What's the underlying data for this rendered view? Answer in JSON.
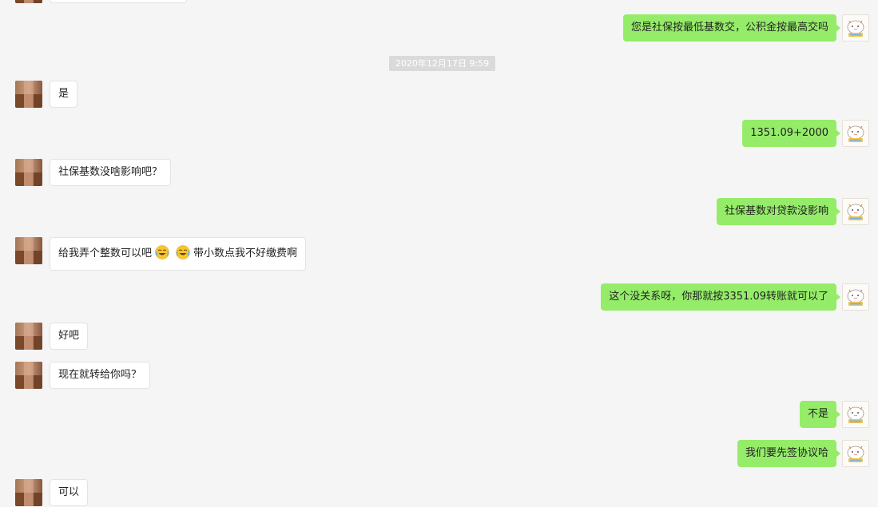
{
  "timestamp": "2020年12月17日 9:59",
  "messages": {
    "m1": {
      "text": "您是社保按最低基数交，公积金按最高交吗",
      "direction": "outgoing"
    },
    "m2": {
      "text": "是",
      "direction": "incoming"
    },
    "m3": {
      "text": "1351.09+2000",
      "direction": "outgoing"
    },
    "m4": {
      "text": "社保基数没啥影响吧？",
      "direction": "incoming"
    },
    "m5": {
      "text": "社保基数对贷款没影响",
      "direction": "outgoing"
    },
    "m6": {
      "text_part1": "给我弄个整数可以吧",
      "text_part2": "带小数点我不好缴费啊",
      "emoji": "laughing-crying-emoji",
      "direction": "incoming"
    },
    "m7": {
      "text": "这个没关系呀，你那就按3351.09转账就可以了",
      "direction": "outgoing"
    },
    "m8": {
      "text": "好吧",
      "direction": "incoming"
    },
    "m9": {
      "text": "现在就转给你吗？",
      "direction": "incoming"
    },
    "m10": {
      "text": "不是",
      "direction": "outgoing"
    },
    "m11": {
      "text": "我们要先签协议哈",
      "direction": "outgoing"
    },
    "m12": {
      "text": "可以",
      "direction": "incoming"
    }
  },
  "colors": {
    "background": "#f5f5f5",
    "outgoing_bubble": "#95ec69",
    "incoming_bubble": "#ffffff",
    "timestamp_bg": "#dadada"
  },
  "icons": {
    "self_avatar": "cartoon-cat-avatar-icon",
    "contact_avatar": "blurred-contact-avatar-icon"
  }
}
